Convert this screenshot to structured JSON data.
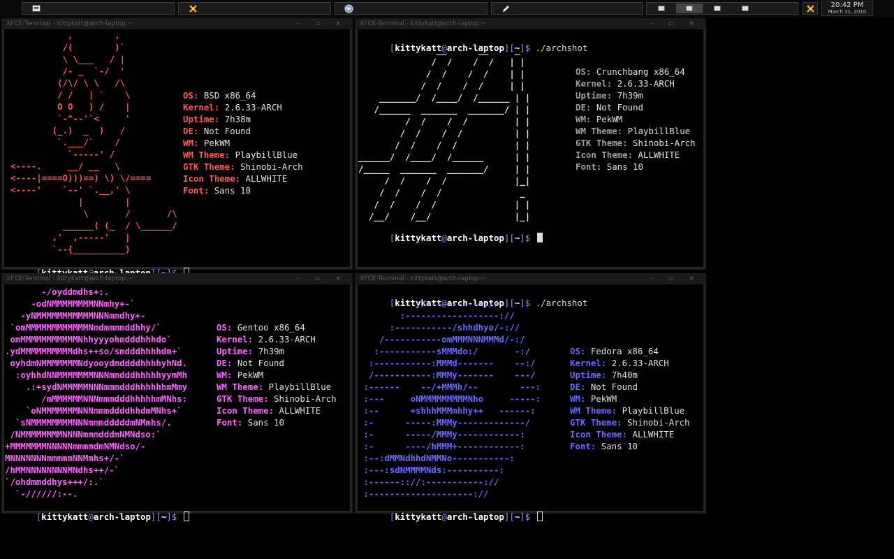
{
  "panel": {
    "clock_time": "20:42 PM",
    "clock_date": "March 21, 2010"
  },
  "colors": {
    "bsd": "#ff5a5a",
    "crunchbang": "#e8e8e8",
    "gentoo": "#ff66ff",
    "fedora": "#6a6aff",
    "bracket": "#8f8fff"
  },
  "windows": {
    "w1": {
      "title": "XFCE-Terminal - kittykatt@arch-laptop:~",
      "ascii": "           ,        ,\n          /(        )`\n          \\ \\___   / |\n          /- _  `-/  '\n         (/\\/ \\ \\   /\\\n         / /   | `    \\\n         O O   ) /    |\n         `-^--'`<     '\n        (_.)  _  )   /\n         `.___/`    /\n           `-----' /\n<----.     __/ __   \\\n<----|====O)))==) \\) \\/====\n<----'    `--' `.__,' \\\n             |        |\n              \\       /       /\\\n          ______( (_  / \\______/\n        ,'  ,-----'   |\n        `--{__________)",
      "info": [
        {
          "k": "OS:",
          "v": "BSD x86_64"
        },
        {
          "k": "Kernel:",
          "v": "2.6.33-ARCH"
        },
        {
          "k": "Uptime:",
          "v": "7h38m"
        },
        {
          "k": "DE:",
          "v": "Not Found"
        },
        {
          "k": "WM:",
          "v": "PekWM"
        },
        {
          "k": "WM Theme:",
          "v": "PlaybillBlue"
        },
        {
          "k": "GTK Theme:",
          "v": "Shinobi-Arch"
        },
        {
          "k": "Icon Theme:",
          "v": "ALLWHITE"
        },
        {
          "k": "Font:",
          "v": "Sans 10"
        }
      ],
      "prompt_user": "kittykatt",
      "prompt_host": "arch-laptop",
      "prompt_path": "~"
    },
    "w2": {
      "title": "XFCE-Terminal - kittykatt@arch-laptop:~",
      "command": "./archshot",
      "ascii": "               __      __     _\n              /  /    /  /   | |\n             /  /    /  /    | |\n            /  /    /  /     | |\n    _______/  /____/  /______ | |\n   /______  _______  _______/ | |\n         /  /    /  /         | |\n        /  /    /  /          | |\n       /  /    /  /           | |\n______/  /____/  /______      | |\n/_____  _______  _______/     | |\n     /  /    /  /             |_|\n    /  /    /  /               _\n   /  /    /  /               | |\n  /__/    /__/                |_|",
      "info": [
        {
          "k": "OS:",
          "v": "Crunchbang x86_64"
        },
        {
          "k": "Kernel:",
          "v": "2.6.33-ARCH"
        },
        {
          "k": "Uptime:",
          "v": "7h39m"
        },
        {
          "k": "DE:",
          "v": "Not Found"
        },
        {
          "k": "WM:",
          "v": "PekWM"
        },
        {
          "k": "WM Theme:",
          "v": "PlaybillBlue"
        },
        {
          "k": "GTK Theme:",
          "v": "Shinobi-Arch"
        },
        {
          "k": "Icon Theme:",
          "v": "ALLWHITE"
        },
        {
          "k": "Font:",
          "v": "Sans 10"
        }
      ]
    },
    "w3": {
      "title": "XFCE-Terminal - kittykatt@arch-laptop:~",
      "ascii": "       -/oyddmdhs+:.\n     -odNMMMMMMMMNNmhy+-`\n   -yNMMMMMMMMMMMNNNmmdhy+-\n `omMMMMMMMMMMMMNmdmmmmddhhy/`\n omMMMMMMMMMMMNhhyyyohmdddhhhdo`\n.ydMMMMMMMMMMdhs++so/smdddhhhhdm+`\n oyhdmNMMMMMMMNdyooydmddddhhhhyhNd.\n  :oyhhdNNMMMMMMMNNNmmdddhhhhhyymMh\n    .:+sydNMMMMMNNNmmmdddhhhhhhmMmy\n       /mMMMMMMNNNmmmdddhhhhhmMNhs:\n    `oNMMMMMMMNNNmmmddddhhdmMNhs+`\n  `sNMMMMMMMMNNNmmmdddddmNMmhs/.\n /NMMMMMMMMNNNNmmmdddmNMNdso:`\n+MMMMMMMNNNNNmmmmdmNMNdso/-\nMNNNNNNNmmmmmNNMmhs+/-`\n/hMMNNNNNNNNMNdhs++/-`\n`/ohdmmddhys+++/:.`\n  `-//////:--.",
      "info": [
        {
          "k": "OS:",
          "v": "Gentoo x86_64"
        },
        {
          "k": "Kernel:",
          "v": "2.6.33-ARCH"
        },
        {
          "k": "Uptime:",
          "v": "7h39m"
        },
        {
          "k": "DE:",
          "v": "Not Found"
        },
        {
          "k": "WM:",
          "v": "PekWM"
        },
        {
          "k": "WM Theme:",
          "v": "PlaybillBlue"
        },
        {
          "k": "GTK Theme:",
          "v": "Shinobi-Arch"
        },
        {
          "k": "Icon Theme:",
          "v": "ALLWHITE"
        },
        {
          "k": "Font:",
          "v": "Sans 10"
        }
      ]
    },
    "w4": {
      "title": "XFCE-Terminal - kittykatt@arch-laptop:~",
      "command": "./archshot",
      "ascii": "           :/-----------://\n        :------------------://\n      :-----------/shhdhyo/-://\n    /-----------omMMMNNNMMMd/-:/\n   :-----------sMMMdo:/       -:/\n  :-----------:MMMd-------    --:/\n  /-----------:MMMy-------    ---/\n :------    --/+MMMh/--        ---:\n :---     oNMMMMMMMMMNho     -----:\n :--      +shhhMMMmhhy++   ------:\n :-      -----:MMMy-------------/\n :-      -----/MMMy------------:\n :-      ----/hMMM+------------:\n :--:dMMNdhhdNMMNo-----------:\n :---:sdNMMMMNds:----------:\n :------:://:-----------://\n :--------------------://",
      "info": [
        {
          "k": "OS:",
          "v": "Fedora x86_64"
        },
        {
          "k": "Kernel:",
          "v": "2.6.33-ARCH"
        },
        {
          "k": "Uptime:",
          "v": "7h40m"
        },
        {
          "k": "DE:",
          "v": "Not Found"
        },
        {
          "k": "WM:",
          "v": "PekWM"
        },
        {
          "k": "WM Theme:",
          "v": "PlaybillBlue"
        },
        {
          "k": "GTK Theme:",
          "v": "Shinobi-Arch"
        },
        {
          "k": "Icon Theme:",
          "v": "ALLWHITE"
        },
        {
          "k": "Font:",
          "v": "Sans 10"
        }
      ]
    }
  },
  "icons": [
    "terminal-icon",
    "tools-icon",
    "browser-icon",
    "editor-icon",
    "tray-tools-icon"
  ]
}
